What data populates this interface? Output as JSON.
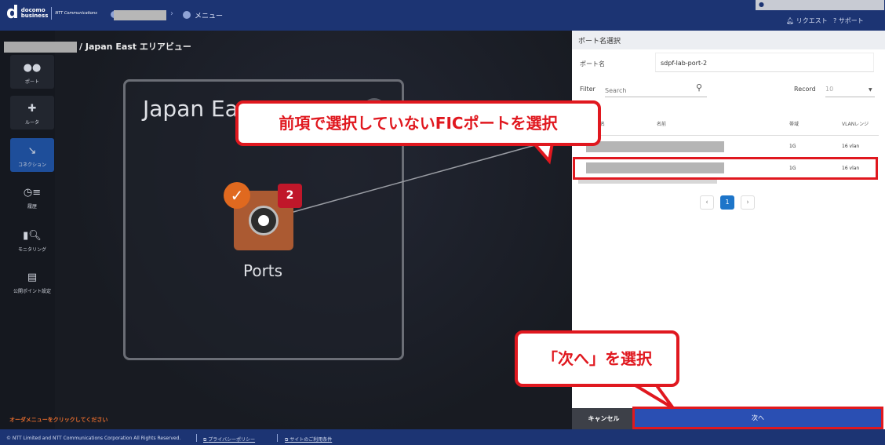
{
  "header": {
    "logo_main": "d",
    "logo_word1": "docomo",
    "logo_word2": "business",
    "logo_ntt": "NTT Communications",
    "menu_label": "メニュー",
    "request_label": "リクエスト",
    "support_label": "サポート"
  },
  "breadcrumb": {
    "area_view": "/ Japan East エリアビュー"
  },
  "sidebar": {
    "items": [
      {
        "label": "ポート",
        "icon": "port-icon"
      },
      {
        "label": "ルータ",
        "icon": "router-icon"
      },
      {
        "label": "コネクション",
        "icon": "connection-icon"
      },
      {
        "label": "履歴",
        "icon": "history-icon"
      },
      {
        "label": "モニタリング",
        "icon": "monitoring-icon"
      },
      {
        "label": "公開ポイント設定",
        "icon": "public-point-icon"
      }
    ]
  },
  "canvas": {
    "area_title": "Japan East",
    "ports_label": "Ports",
    "ports_count": "2",
    "order_hint": "オーダメニューをクリックしてください"
  },
  "annotations": {
    "callout_select_port": "前項で選択していないFICポートを選択",
    "callout_next": "「次へ」を選択"
  },
  "panel": {
    "title": "ポート名選択",
    "port_name_label": "ポート名",
    "port_name_value": "sdpf-lab-port-2",
    "filter_label": "Filter",
    "search_placeholder": "Search",
    "record_label": "Record",
    "record_value": "10",
    "columns": [
      "名",
      "名前",
      "帯域",
      "VLANレンジ"
    ],
    "rows": [
      {
        "bandwidth": "1G",
        "vlan": "16 vlan"
      },
      {
        "bandwidth": "1G",
        "vlan": "16 vlan"
      }
    ],
    "pagination": {
      "prev": "‹",
      "current": "1",
      "next": "›"
    },
    "cancel_label": "キャンセル",
    "next_label": "次へ"
  },
  "footer": {
    "copyright": "© NTT Limited and NTT Communications Corporation All Rights Reserved.",
    "privacy": "プライバシーポリシー",
    "terms": "サイトのご利用条件"
  },
  "colors": {
    "header_bg": "#1c3473",
    "accent_blue": "#2a4fb3",
    "highlight_red": "#e0181f",
    "ports_tile": "#ab5a32"
  }
}
